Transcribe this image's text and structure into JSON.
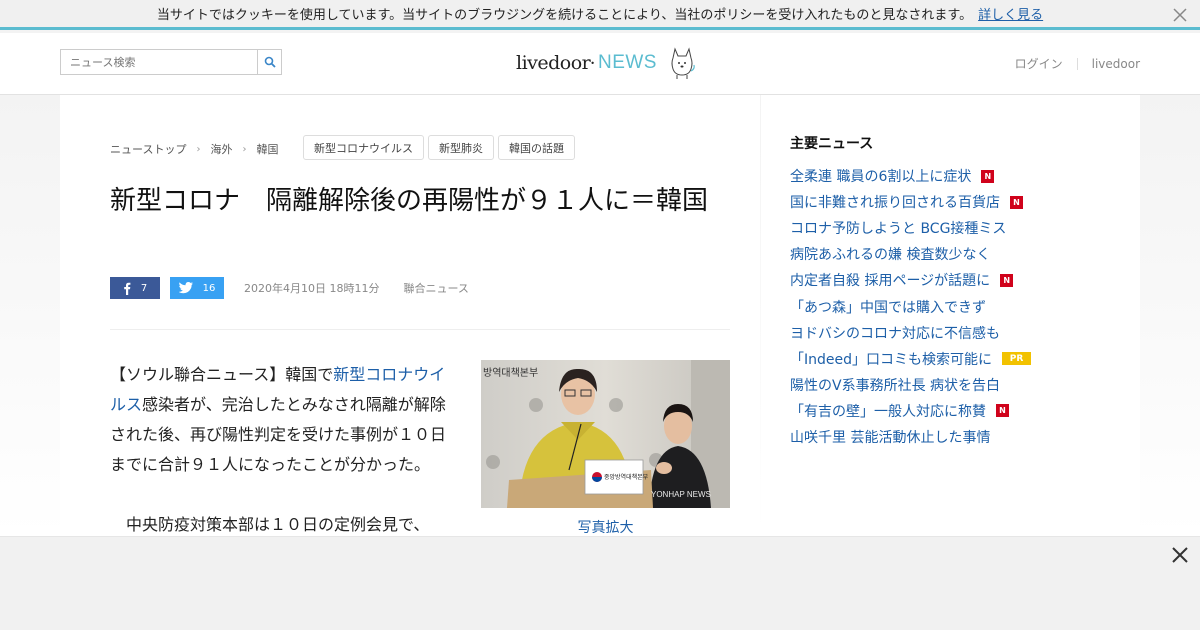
{
  "cookie_banner": {
    "message": "当サイトではクッキーを使用しています。当サイトのブラウジングを続けることにより、当社のポリシーを受け入れたものと見なされます。",
    "link_label": "詳しく見る"
  },
  "header": {
    "search_placeholder": "ニュース検索",
    "logo_main": "livedoor",
    "logo_dot": "•",
    "logo_news": "NEWS",
    "login_label": "ログイン",
    "livedoor_label": "livedoor"
  },
  "breadcrumb": [
    "ニューストップ",
    "海外",
    "韓国"
  ],
  "tags": [
    "新型コロナウイルス",
    "新型肺炎",
    "韓国の話題"
  ],
  "article": {
    "title": "新型コロナ　隔離解除後の再陽性が９１人に＝韓国",
    "facebook_count": "7",
    "twitter_count": "16",
    "date": "2020年4月10日 18時11分",
    "source": "聯合ニュース",
    "para1_pre": "【ソウル聯合ニュース】韓国で",
    "para1_link": "新型コロナウイルス",
    "para1_post": "感染者が、完治したとみなされ隔離が解除された後、再び陽性判定を受けた事例が１０日までに合計９１人になったことが分かった。",
    "para2": "中央防疫対策本部は１０日の定例会見で、",
    "photo_sign_text": "방역대책본부",
    "photo_podium_text": "중앙방역대책본부",
    "photo_watermark": "YONHAP NEWS",
    "photo_caption": "写真拡大"
  },
  "sidebar": {
    "title": "主要ニュース",
    "items": [
      {
        "label": "全柔連 職員の6割以上に症状",
        "badge": "N"
      },
      {
        "label": "国に非難され振り回される百貨店",
        "badge": "N"
      },
      {
        "label": "コロナ予防しようと BCG接種ミス",
        "badge": ""
      },
      {
        "label": "病院あふれるの嫌 検査数少なく",
        "badge": ""
      },
      {
        "label": "内定者自殺 採用ページが話題に",
        "badge": "N"
      },
      {
        "label": "「あつ森」中国では購入できず",
        "badge": ""
      },
      {
        "label": "ヨドバシのコロナ対応に不信感も",
        "badge": ""
      },
      {
        "label": "「Indeed」口コミも検索可能に",
        "badge": "PR"
      },
      {
        "label": "陽性のV系事務所社長 病状を告白",
        "badge": ""
      },
      {
        "label": "「有吉の壁」一般人対応に称賛",
        "badge": "N"
      },
      {
        "label": "山咲千里 芸能活動休止した事情",
        "badge": ""
      }
    ]
  },
  "colors": {
    "accent": "#5bbcd0",
    "link": "#1d5fa8",
    "facebook": "#3b5998",
    "twitter": "#38a1f3",
    "badge_new": "#d0021b",
    "badge_pr": "#f2c200"
  }
}
